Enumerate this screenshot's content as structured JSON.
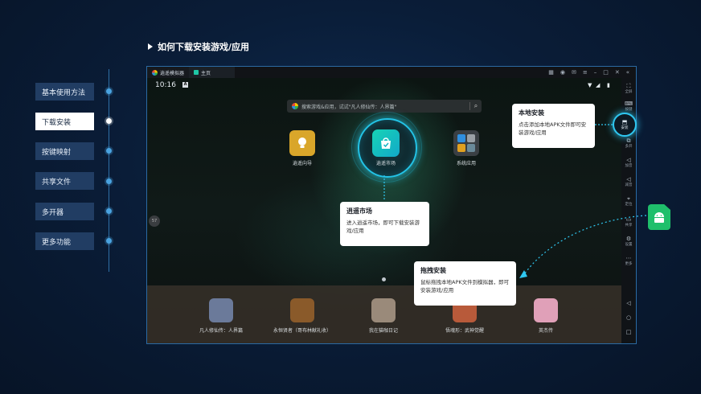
{
  "heading": "如何下载安装游戏/应用",
  "nav": {
    "items": [
      {
        "label": "基本使用方法",
        "active": false
      },
      {
        "label": "下载安装",
        "active": true
      },
      {
        "label": "按键映射",
        "active": false
      },
      {
        "label": "共享文件",
        "active": false
      },
      {
        "label": "多开器",
        "active": false
      },
      {
        "label": "更多功能",
        "active": false
      }
    ]
  },
  "emulator": {
    "app_name": "逍遥模拟器",
    "tab_name": "主页",
    "time": "10:16",
    "a_badge": "A",
    "search_placeholder": "搜索游戏&应用，试试\"凡人修仙传：人界篇\"",
    "apps": [
      {
        "label": "逍遥向导",
        "color": "#d9a62a"
      },
      {
        "label": "逍遥市场",
        "color": "#17c7b8"
      },
      {
        "label": "系统应用",
        "color": "#3a3f44"
      }
    ],
    "side_button": "57",
    "dock": [
      {
        "label": "凡人修仙传：人界篇",
        "color": "#6b7a9a"
      },
      {
        "label": "永恒贤者（哥布林献礼收）",
        "color": "#8a5a2a"
      },
      {
        "label": "我在猫咖日记",
        "color": "#9a8a7a"
      },
      {
        "label": "悟魂形：武神觉醒",
        "color": "#b85a3a"
      },
      {
        "label": "英杰传",
        "color": "#e0a0b8"
      }
    ],
    "toolbar": [
      {
        "icon": "expand-icon",
        "glyph": "⛶",
        "label": "全屏"
      },
      {
        "icon": "keyboard-icon",
        "glyph": "⌨",
        "label": "按键"
      },
      {
        "icon": "install-icon",
        "glyph": "⬒",
        "label": "安装"
      },
      {
        "icon": "multi-icon",
        "glyph": "⧉",
        "label": "多开"
      },
      {
        "icon": "volume-up-icon",
        "glyph": "◁",
        "label": "加音"
      },
      {
        "icon": "volume-down-icon",
        "glyph": "◁",
        "label": "减音"
      },
      {
        "icon": "location-icon",
        "glyph": "⌖",
        "label": "定位"
      },
      {
        "icon": "share-icon",
        "glyph": "▭",
        "label": "共享"
      },
      {
        "icon": "settings-icon",
        "glyph": "⚙",
        "label": "设置"
      },
      {
        "icon": "more-icon",
        "glyph": "⋯",
        "label": "更多"
      }
    ],
    "nav_buttons": [
      {
        "icon": "back-icon",
        "glyph": "◁"
      },
      {
        "icon": "home-icon",
        "glyph": "○"
      },
      {
        "icon": "recent-icon",
        "glyph": "□"
      }
    ]
  },
  "tooltips": {
    "local_install": {
      "title": "本地安装",
      "desc": "点击添加本地APK文件即可安装游戏/应用"
    },
    "market": {
      "title": "逍遥市场",
      "desc": "进入逍遥市场，即可下载安装游戏/应用"
    },
    "drag_install": {
      "title": "拖拽安装",
      "desc": "鼠标拖拽本地APK文件到模拟器，即可安装游戏/应用"
    }
  },
  "highlight": {
    "label": "安装"
  },
  "colors": {
    "accent": "#23c3e6",
    "apk_green": "#1fbf6b",
    "nav_active": "#ffffff",
    "nav_bg": "#213d63"
  }
}
